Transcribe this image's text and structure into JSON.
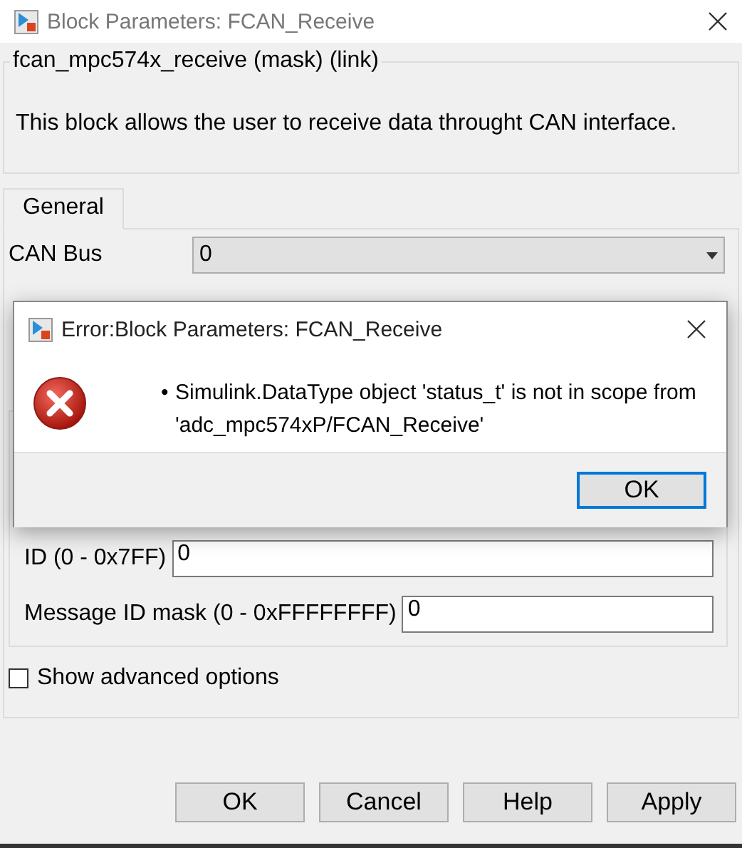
{
  "window": {
    "title": "Block Parameters: FCAN_Receive"
  },
  "description": {
    "heading": "fcan_mpc574x_receive (mask) (link)",
    "text": "This block allows the user to receive data throught CAN interface."
  },
  "tabs": [
    {
      "label": "General",
      "selected": true
    }
  ],
  "parameters": [
    {
      "kind": "dropdown",
      "label": "CAN Bus",
      "value": "0"
    }
  ],
  "group": [
    {
      "kind": "text",
      "label": "ID (0 - 0x7FF)",
      "value": "0"
    },
    {
      "kind": "text",
      "label": "Message ID mask (0 - 0xFFFFFFFF)",
      "value": "0"
    }
  ],
  "advanced": {
    "label": "Show advanced options",
    "checked": false
  },
  "buttons": [
    "OK",
    "Cancel",
    "Help",
    "Apply"
  ],
  "error_dialog": {
    "title": "Error:Block Parameters: FCAN_Receive",
    "messages": [
      {
        "bullet": "•",
        "text": "Simulink.DataType object 'status_t' is not in scope from 'adc_mpc574xP/FCAN_Receive'"
      }
    ],
    "buttons": [
      {
        "label": "OK",
        "default": true
      }
    ]
  }
}
